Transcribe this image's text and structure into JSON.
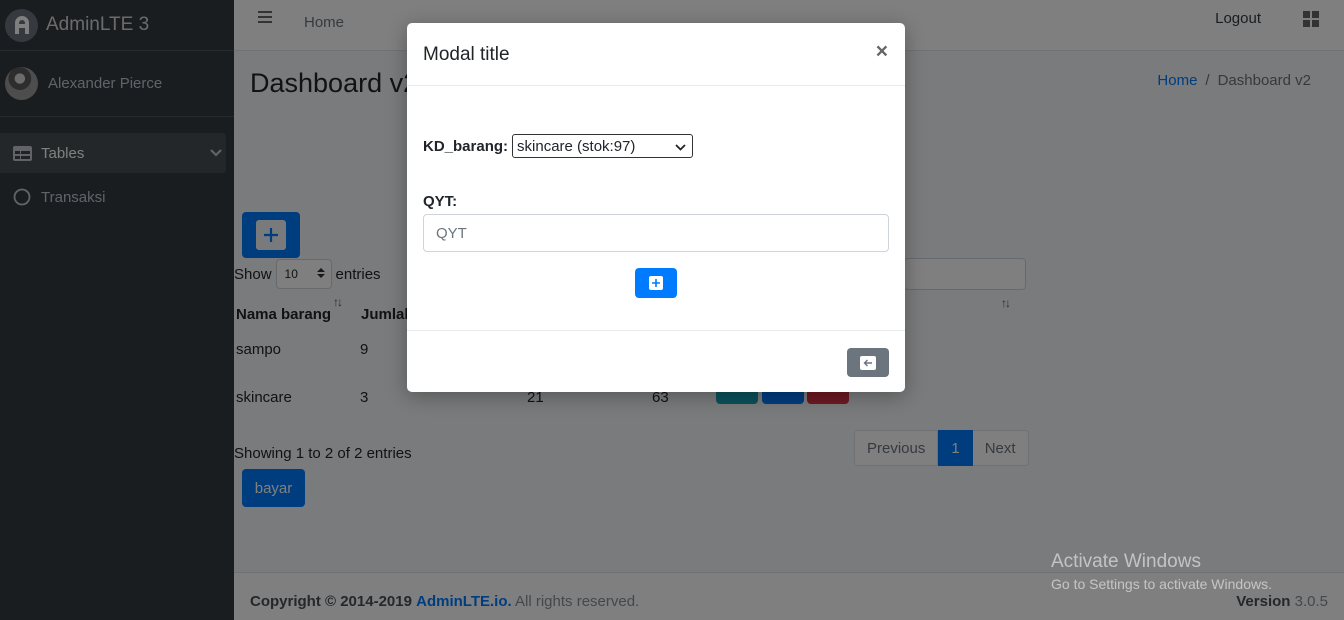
{
  "brand": {
    "name": "AdminLTE 3"
  },
  "user": {
    "name": "Alexander Pierce"
  },
  "sidebar": {
    "items": [
      {
        "label": "Tables",
        "icon": "table-icon"
      },
      {
        "label": "Transaksi",
        "icon": "circle-icon"
      }
    ]
  },
  "header": {
    "home": "Home",
    "logout": "Logout"
  },
  "page": {
    "title": "Dashboard v2",
    "breadcrumb": {
      "home": "Home",
      "sep": "/",
      "current": "Dashboard v2"
    }
  },
  "table": {
    "show_label": "Show",
    "show_value": "10",
    "entries_label": "entries",
    "columns": [
      "Nama barang",
      "Jumlah"
    ],
    "rows": [
      {
        "nama": "sampo",
        "jumlah": "9"
      },
      {
        "nama": "skincare",
        "jumlah": "3",
        "c3": "21",
        "c4": "63"
      }
    ],
    "showing": "Showing 1 to 2 of 2 entries",
    "pager": {
      "prev": "Previous",
      "current": "1",
      "next": "Next"
    },
    "pay_label": "bayar"
  },
  "modal": {
    "title": "Modal title",
    "close": "×",
    "kd_label": "KD_barang:",
    "kd_value": "skincare (stok:97)",
    "qyt_label": "QYT:",
    "qyt_placeholder": "QYT"
  },
  "footer": {
    "copyright": "Copyright © 2014-2019",
    "link": "AdminLTE.io.",
    "rights": "All rights reserved.",
    "version_label": "Version",
    "version": "3.0.5"
  },
  "watermark": {
    "line1": "Activate Windows",
    "line2": "Go to Settings to activate Windows."
  },
  "colors": {
    "primary": "#007bff",
    "sidebar": "#343a40",
    "secondary": "#6c757d",
    "info": "#17a2b8",
    "danger": "#dc3545"
  }
}
